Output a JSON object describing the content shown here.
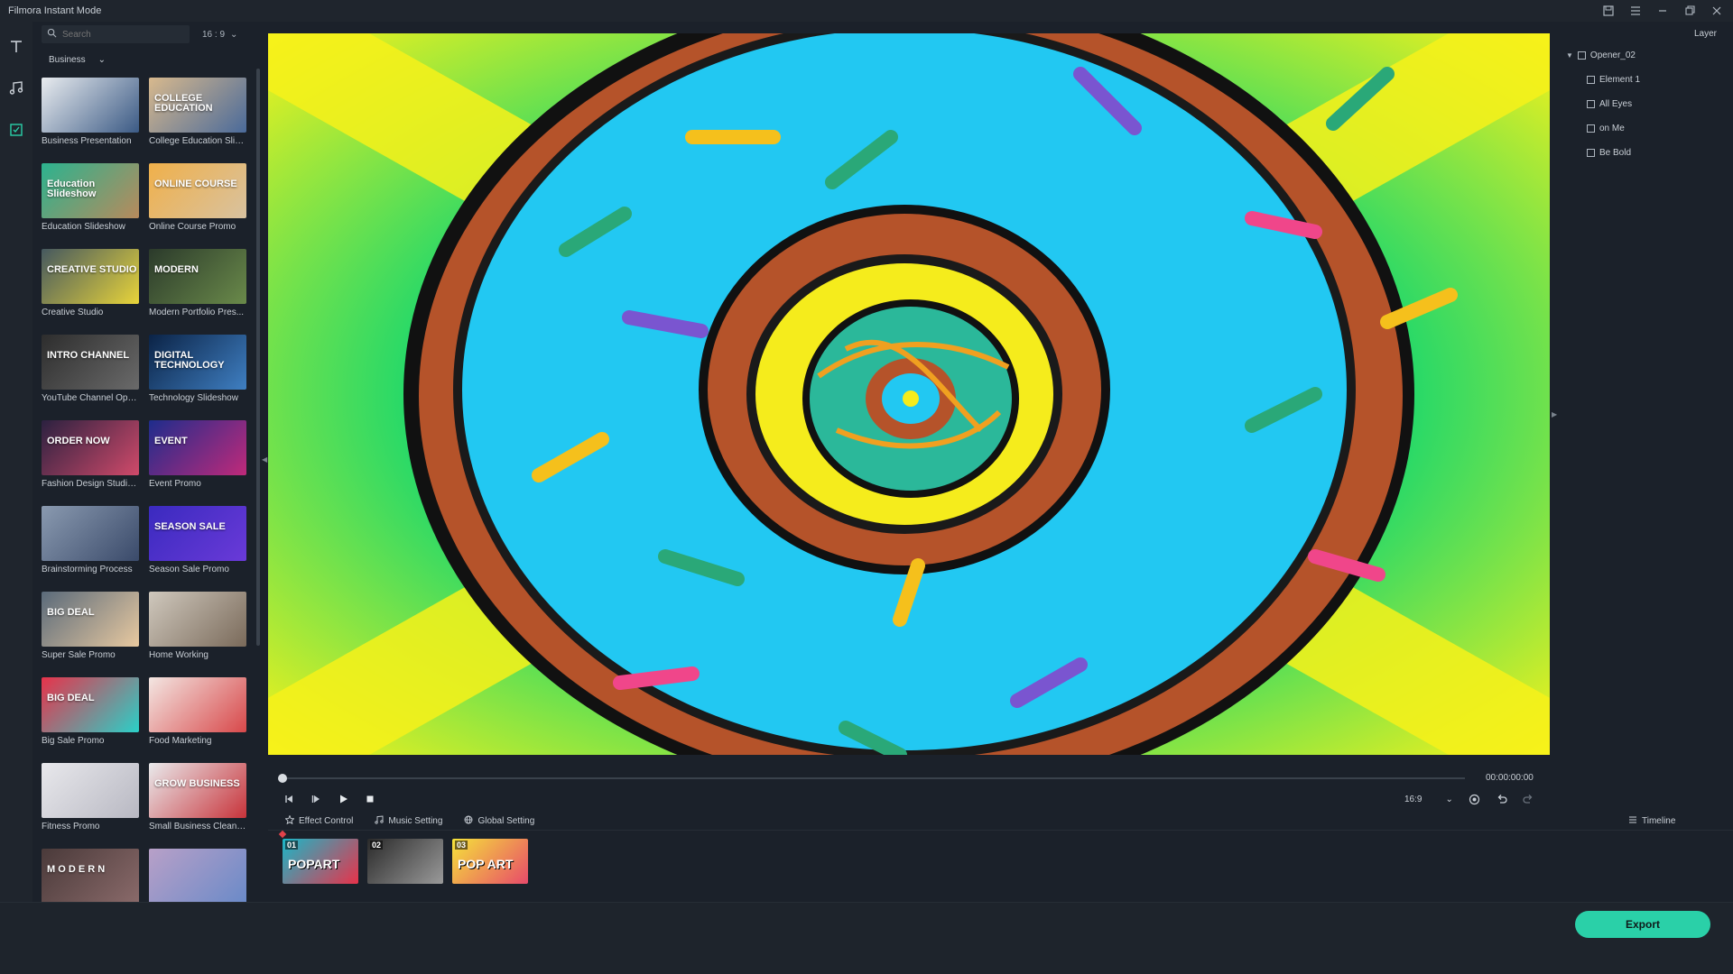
{
  "app": {
    "title": "Filmora Instant Mode",
    "icons": [
      "save-icon",
      "list-icon",
      "minimize-icon",
      "restore-icon",
      "close-icon"
    ]
  },
  "left_toolbar": {
    "items": [
      {
        "name": "text-tool-icon"
      },
      {
        "name": "music-tool-icon"
      },
      {
        "name": "template-tool-icon"
      }
    ]
  },
  "library": {
    "search_placeholder": "Search",
    "aspect_ratio": "16 : 9",
    "category": "Business",
    "templates": [
      {
        "label": "Business Presentation",
        "thumb_text": "",
        "colors": [
          "#e9ecef",
          "#3b5a85"
        ]
      },
      {
        "label": "College Education Slides",
        "thumb_text": "COLLEGE EDUCATION",
        "colors": [
          "#d8b98d",
          "#4a6a9a"
        ]
      },
      {
        "label": "Education Slideshow",
        "thumb_text": "Education Slideshow",
        "colors": [
          "#2bb38f",
          "#b88a5c"
        ]
      },
      {
        "label": "Online Course Promo",
        "thumb_text": "ONLINE COURSE",
        "colors": [
          "#f0b04a",
          "#d8c2a0"
        ]
      },
      {
        "label": "Creative Studio",
        "thumb_text": "CREATIVE STUDIO",
        "colors": [
          "#45585f",
          "#e8d43a"
        ]
      },
      {
        "label": "Modern Portfolio Pres...",
        "thumb_text": "MODERN",
        "colors": [
          "#2b3a2b",
          "#6a8a4a"
        ]
      },
      {
        "label": "YouTube Channel Ope...",
        "thumb_text": "INTRO CHANNEL",
        "colors": [
          "#2d2d2d",
          "#6a6a6a"
        ]
      },
      {
        "label": "Technology Slideshow",
        "thumb_text": "DIGITAL TECHNOLOGY",
        "colors": [
          "#0b2346",
          "#3f7fc2"
        ]
      },
      {
        "label": "Fashion Design Studio ...",
        "thumb_text": "ORDER NOW",
        "colors": [
          "#2b2140",
          "#d04a6a"
        ]
      },
      {
        "label": "Event Promo",
        "thumb_text": "EVENT",
        "colors": [
          "#1e2c8c",
          "#c02a7a"
        ]
      },
      {
        "label": "Brainstorming Process",
        "thumb_text": "",
        "colors": [
          "#8a9ab0",
          "#3a4a6a"
        ]
      },
      {
        "label": "Season Sale Promo",
        "thumb_text": "SEASON SALE",
        "colors": [
          "#3a2abf",
          "#6a3ad8"
        ]
      },
      {
        "label": "Super Sale Promo",
        "thumb_text": "BIG DEAL",
        "colors": [
          "#5a6a7a",
          "#e8c9a0"
        ]
      },
      {
        "label": "Home Working",
        "thumb_text": "",
        "colors": [
          "#cfc8bd",
          "#7a6a5a"
        ]
      },
      {
        "label": "Big Sale Promo",
        "thumb_text": "BIG DEAL",
        "colors": [
          "#e8324a",
          "#2ad0c8"
        ]
      },
      {
        "label": "Food Marketing",
        "thumb_text": "",
        "colors": [
          "#f3e6e2",
          "#d8484a"
        ]
      },
      {
        "label": "Fitness Promo",
        "thumb_text": "",
        "colors": [
          "#e8e8ec",
          "#b8b8c2"
        ]
      },
      {
        "label": "Small Business Clean P...",
        "thumb_text": "GROW BUSINESS",
        "colors": [
          "#e9eaec",
          "#c8333a"
        ]
      },
      {
        "label": "",
        "thumb_text": "M O D E R N",
        "colors": [
          "#4a3a3a",
          "#8a6a6a"
        ]
      },
      {
        "label": "",
        "thumb_text": "",
        "colors": [
          "#b8a0c8",
          "#6a8ac8"
        ]
      }
    ]
  },
  "player": {
    "time": "00:00:00:00",
    "aspect_ratio": "16:9",
    "progress": 0,
    "buttons": [
      "step-back-icon",
      "step-forward-icon",
      "play-icon",
      "stop-icon"
    ],
    "right_buttons": [
      "snapshot-icon",
      "undo-icon",
      "redo-icon"
    ]
  },
  "bottom_tabs": [
    {
      "label": "Effect Control",
      "icon": "effect-icon"
    },
    {
      "label": "Music Setting",
      "icon": "music-icon"
    },
    {
      "label": "Global Setting",
      "icon": "globe-icon"
    }
  ],
  "timeline_button": "Timeline",
  "clips": [
    {
      "number": "01",
      "text": "POPART",
      "colors": [
        "#1ab8c8",
        "#e8324a"
      ]
    },
    {
      "number": "02",
      "text": "",
      "colors": [
        "#2a2a2a",
        "#9a9a9a"
      ]
    },
    {
      "number": "03",
      "text": "POP ART",
      "colors": [
        "#f5e33a",
        "#e84a6a"
      ]
    }
  ],
  "layer_panel": {
    "title": "Layer",
    "root": "Opener_02",
    "items": [
      "Element 1",
      "All Eyes",
      "on Me",
      "Be Bold"
    ]
  },
  "footer": {
    "export_label": "Export",
    "accent": "#2ad0a8"
  }
}
